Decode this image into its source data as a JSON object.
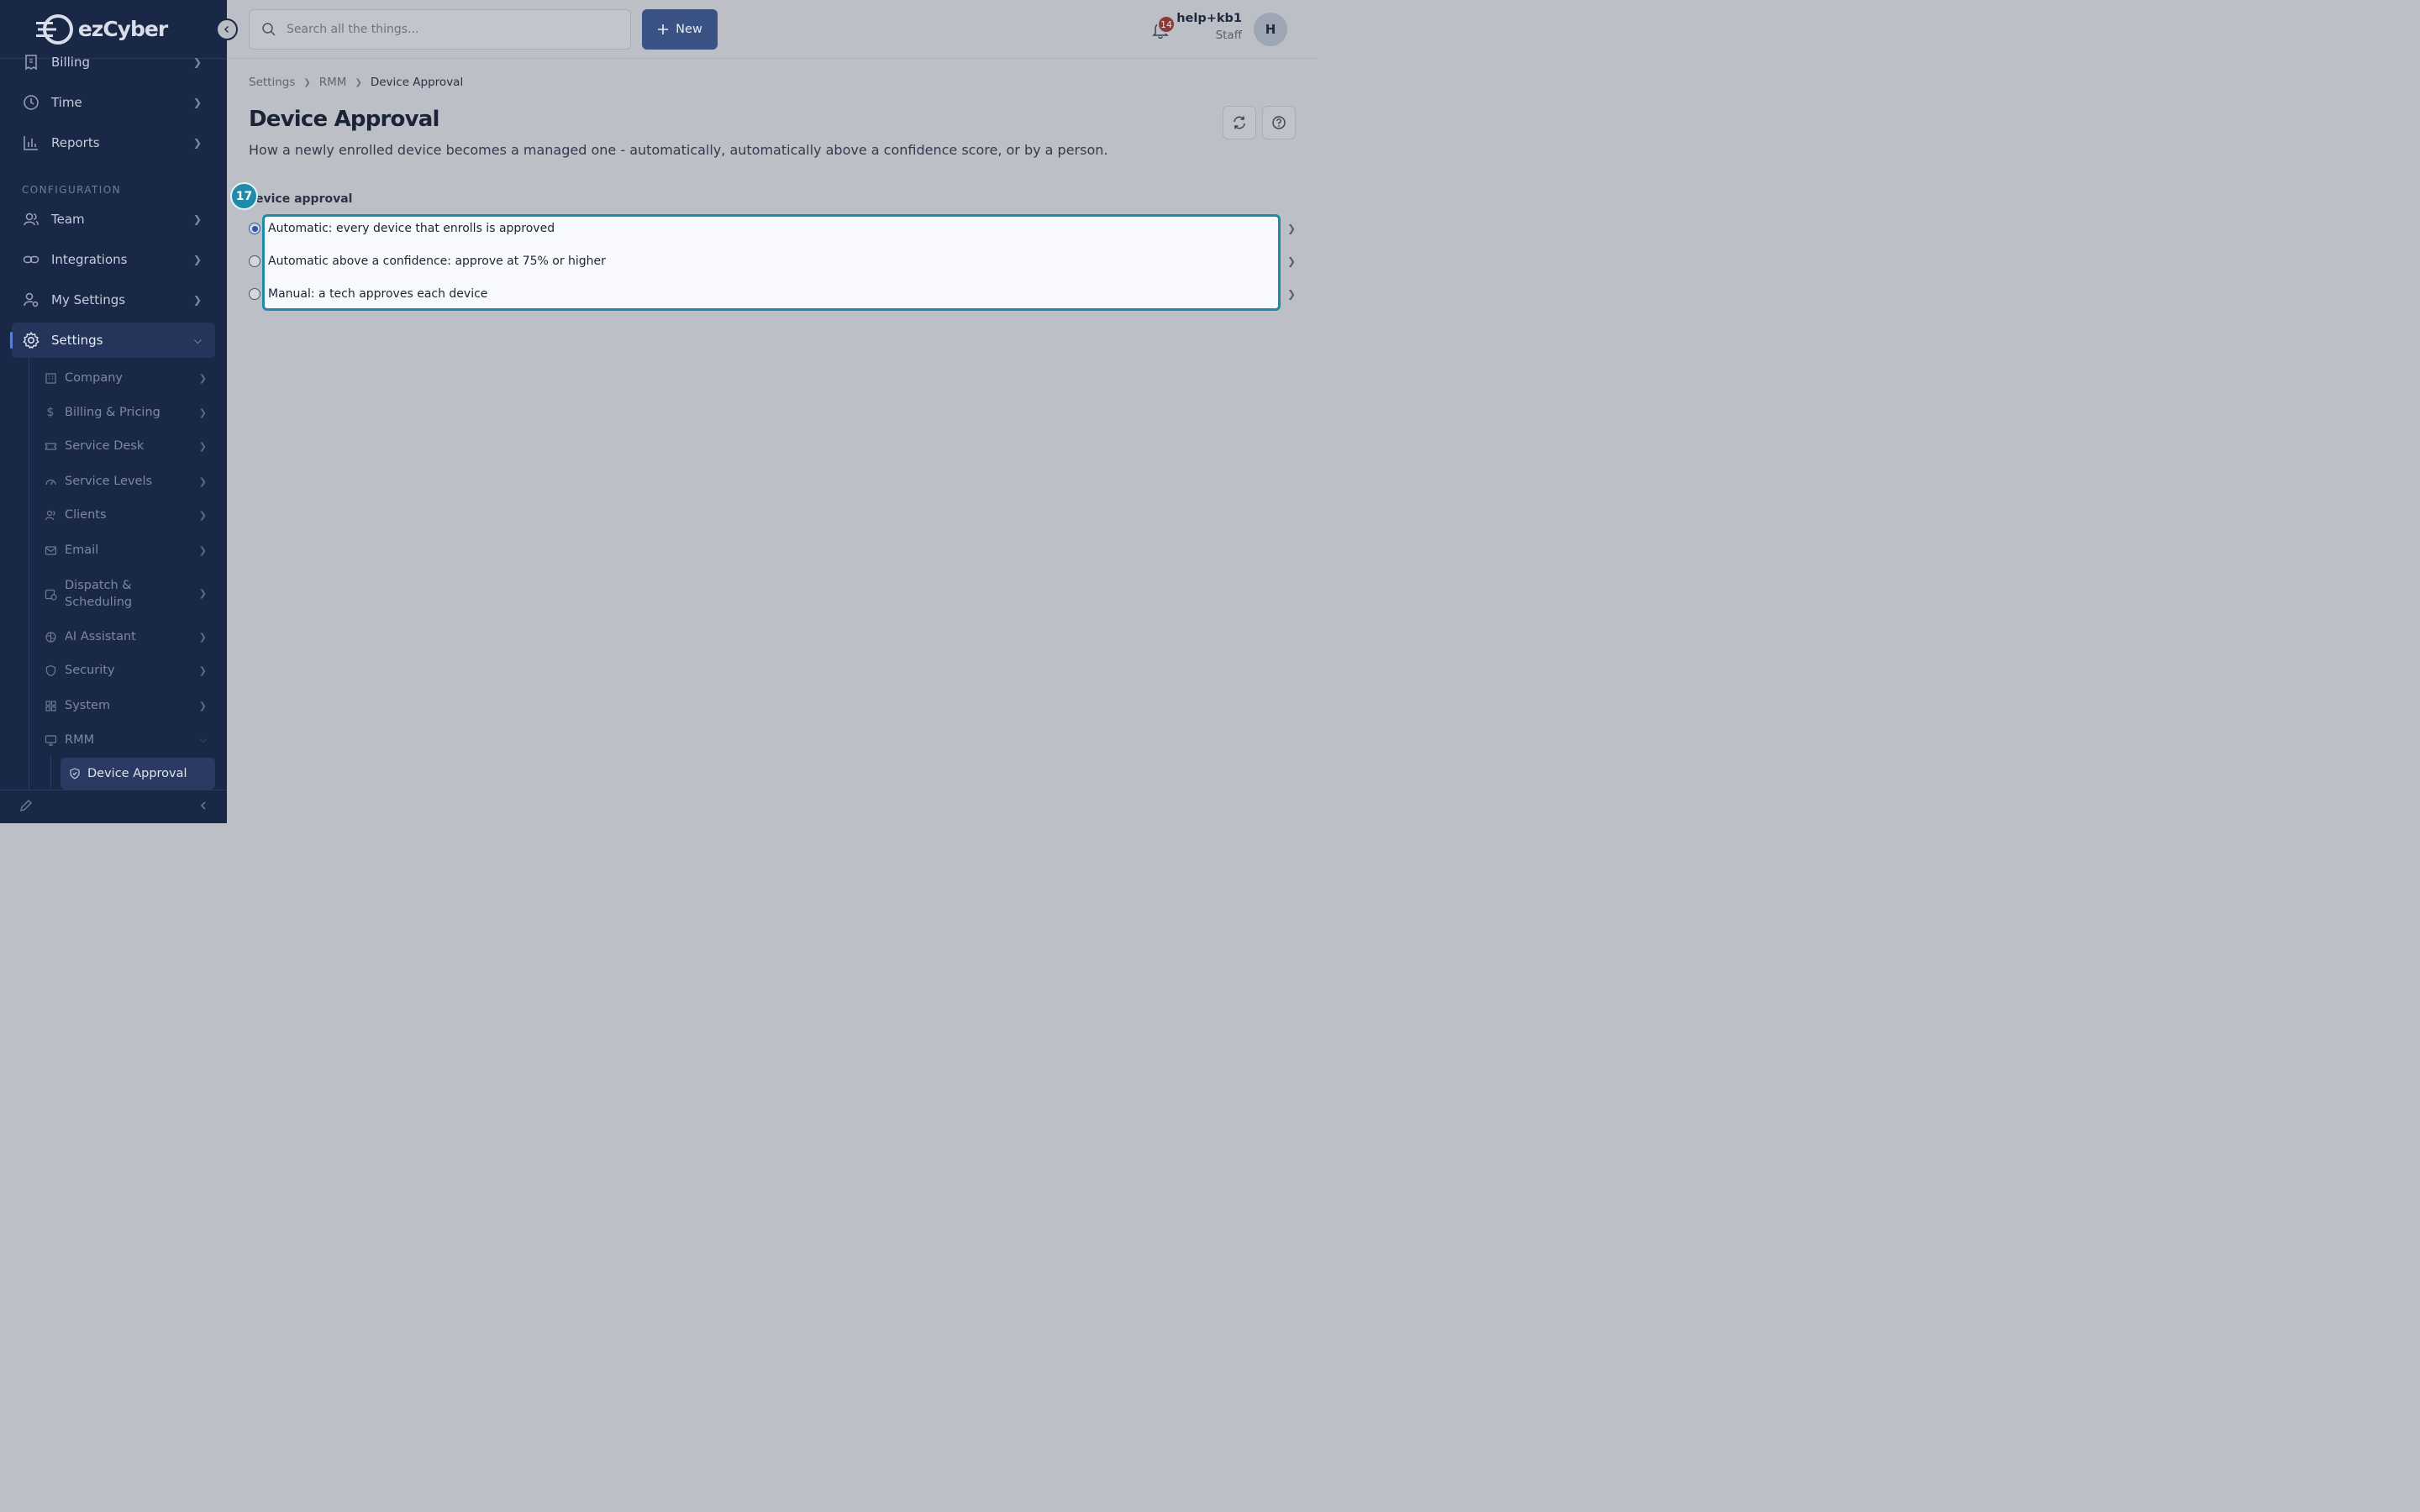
{
  "brand": {
    "name": "ezCyber"
  },
  "sidebar": {
    "items_top": [
      {
        "label": "Billing",
        "icon": "receipt-icon"
      },
      {
        "label": "Time",
        "icon": "clock-icon"
      },
      {
        "label": "Reports",
        "icon": "bar-chart-icon"
      }
    ],
    "section_label": "CONFIGURATION",
    "items_config": [
      {
        "label": "Team",
        "icon": "users-icon"
      },
      {
        "label": "Integrations",
        "icon": "link-icon"
      },
      {
        "label": "My Settings",
        "icon": "user-gear-icon"
      },
      {
        "label": "Settings",
        "icon": "gear-icon"
      }
    ],
    "settings_sub": [
      {
        "label": "Company",
        "icon": "building-icon"
      },
      {
        "label": "Billing & Pricing",
        "icon": "dollar-icon"
      },
      {
        "label": "Service Desk",
        "icon": "ticket-icon"
      },
      {
        "label": "Service Levels",
        "icon": "gauge-icon"
      },
      {
        "label": "Clients",
        "icon": "users-icon"
      },
      {
        "label": "Email",
        "icon": "mail-icon"
      },
      {
        "label": "Dispatch & Scheduling",
        "icon": "calendar-clock-icon"
      },
      {
        "label": "AI Assistant",
        "icon": "brain-icon"
      },
      {
        "label": "Security",
        "icon": "shield-icon"
      },
      {
        "label": "System",
        "icon": "grid-icon"
      },
      {
        "label": "RMM",
        "icon": "monitor-icon"
      }
    ],
    "rmm_sub": [
      {
        "label": "Device Approval",
        "icon": "shield-check-icon"
      }
    ]
  },
  "header": {
    "search_placeholder": "Search all the things...",
    "new_label": "New",
    "notification_count": "14",
    "user_name": "help+kb1",
    "user_role": "Staff",
    "avatar_initial": "H"
  },
  "breadcrumb": [
    "Settings",
    "RMM",
    "Device Approval"
  ],
  "page": {
    "title": "Device Approval",
    "description": "How a newly enrolled device becomes a managed one - automatically, automatically above a confidence score, or by a person.",
    "section_title": "evice approval",
    "step_badge": "17",
    "options": [
      {
        "label": "Automatic: every device that enrolls is approved",
        "checked": true
      },
      {
        "label": "Automatic above a confidence: approve at 75% or higher",
        "checked": false
      },
      {
        "label": "Manual: a tech approves each device",
        "checked": false
      }
    ]
  },
  "colors": {
    "sidebar_bg": "#1a2848",
    "accent": "#1f8bab",
    "primary_button": "#3a5284"
  }
}
